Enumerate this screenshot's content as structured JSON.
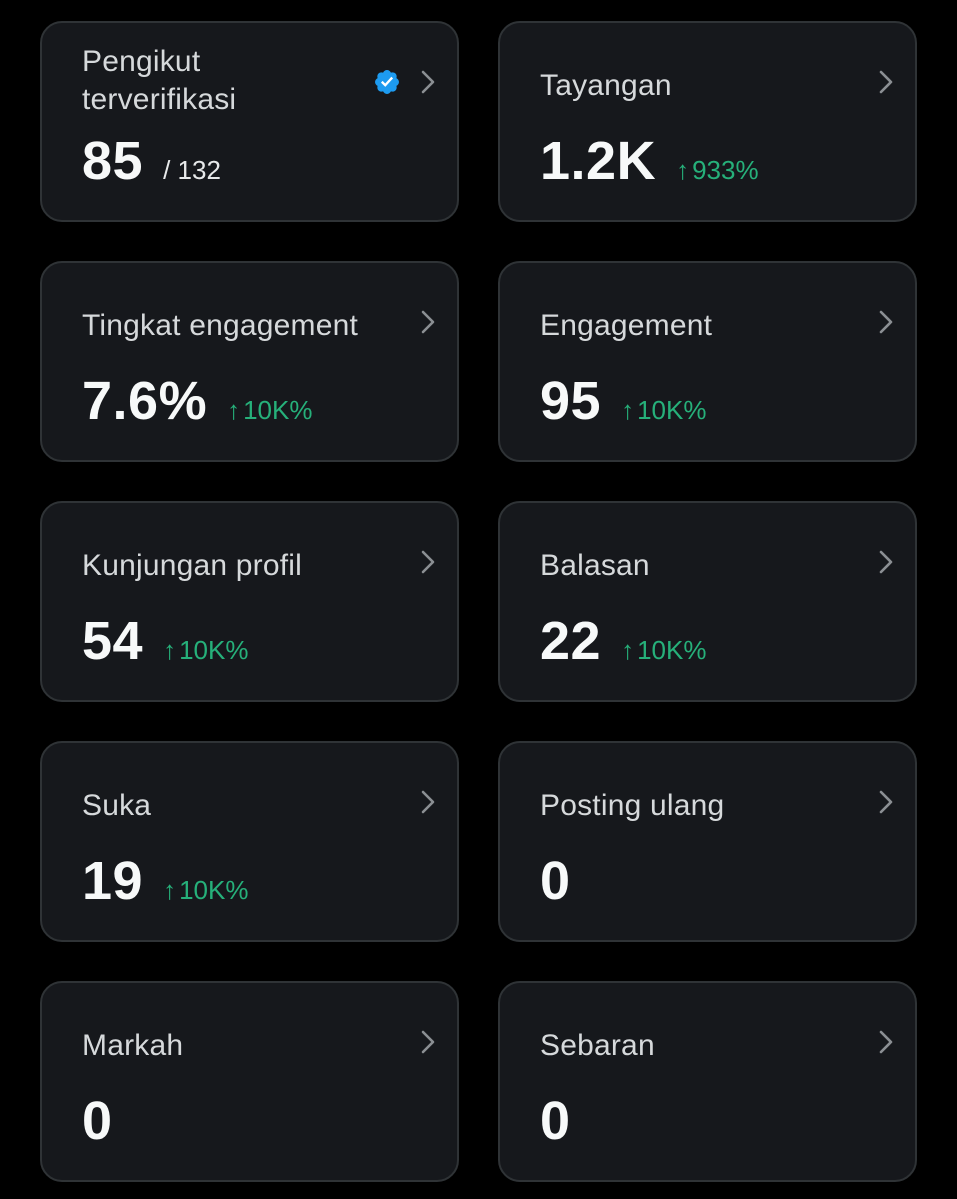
{
  "colors": {
    "background": "#000000",
    "card_background": "#16181c",
    "card_border": "#2f3336",
    "trend_up": "#26b07a",
    "verified_badge": "#1d9bf0"
  },
  "cards": [
    {
      "title": "Pengikut terverifikasi",
      "value": "85",
      "subvalue": "/ 132",
      "icon": "verified-badge-icon"
    },
    {
      "title": "Tayangan",
      "value": "1.2K",
      "trend": "933%",
      "trend_arrow": "↑"
    },
    {
      "title": "Tingkat engagement",
      "value": "7.6%",
      "trend": "10K%",
      "trend_arrow": "↑"
    },
    {
      "title": "Engagement",
      "value": "95",
      "trend": "10K%",
      "trend_arrow": "↑"
    },
    {
      "title": "Kunjungan profil",
      "value": "54",
      "trend": "10K%",
      "trend_arrow": "↑"
    },
    {
      "title": "Balasan",
      "value": "22",
      "trend": "10K%",
      "trend_arrow": "↑"
    },
    {
      "title": "Suka",
      "value": "19",
      "trend": "10K%",
      "trend_arrow": "↑"
    },
    {
      "title": "Posting ulang",
      "value": "0"
    },
    {
      "title": "Markah",
      "value": "0"
    },
    {
      "title": "Sebaran",
      "value": "0"
    }
  ]
}
